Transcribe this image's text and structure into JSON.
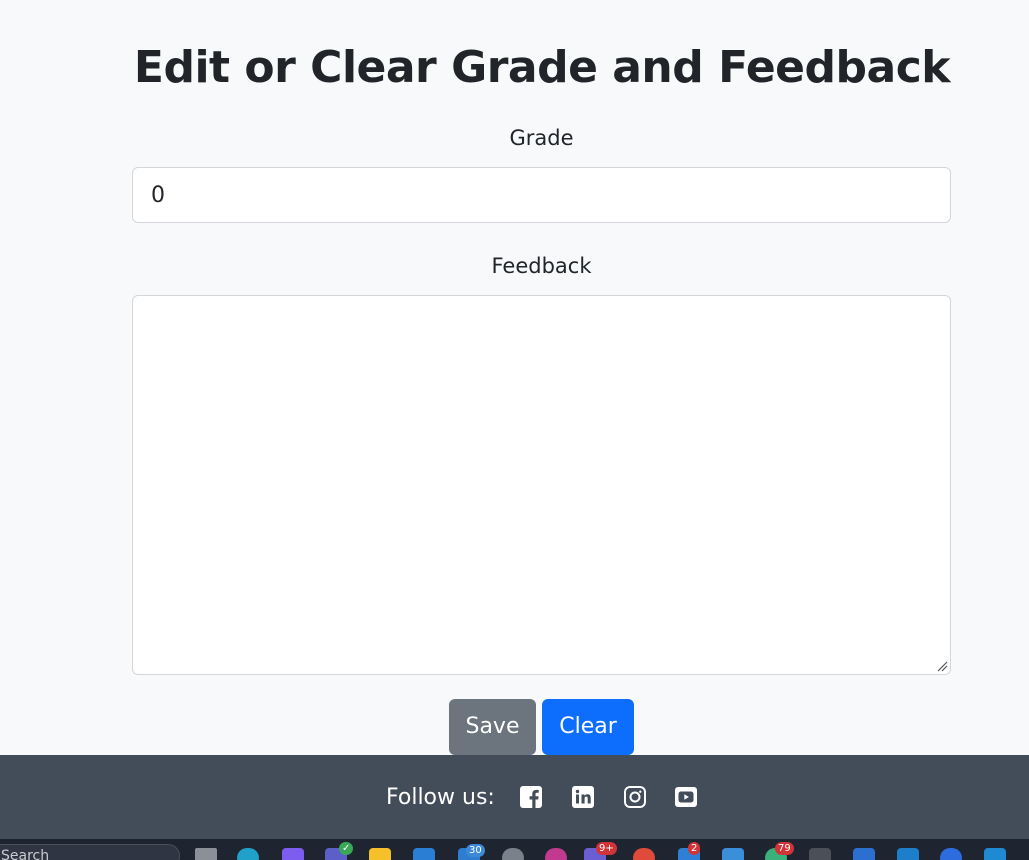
{
  "page": {
    "title": "Edit or Clear Grade and Feedback"
  },
  "form": {
    "grade_label": "Grade",
    "grade_value": "0",
    "feedback_label": "Feedback",
    "feedback_value": ""
  },
  "actions": {
    "save_label": "Save",
    "clear_label": "Clear"
  },
  "footer": {
    "follow_label": "Follow us:",
    "social": [
      "facebook-icon",
      "linkedin-icon",
      "instagram-icon",
      "youtube-icon"
    ]
  },
  "taskbar": {
    "search_placeholder": "Search",
    "badges": {
      "store": "30",
      "chat": "9+",
      "app1": "2",
      "app2": "79"
    }
  },
  "colors": {
    "background": "#f8f9fa",
    "save_button": "#6c757d",
    "clear_button": "#0d6efd",
    "footer": "#424d59"
  }
}
